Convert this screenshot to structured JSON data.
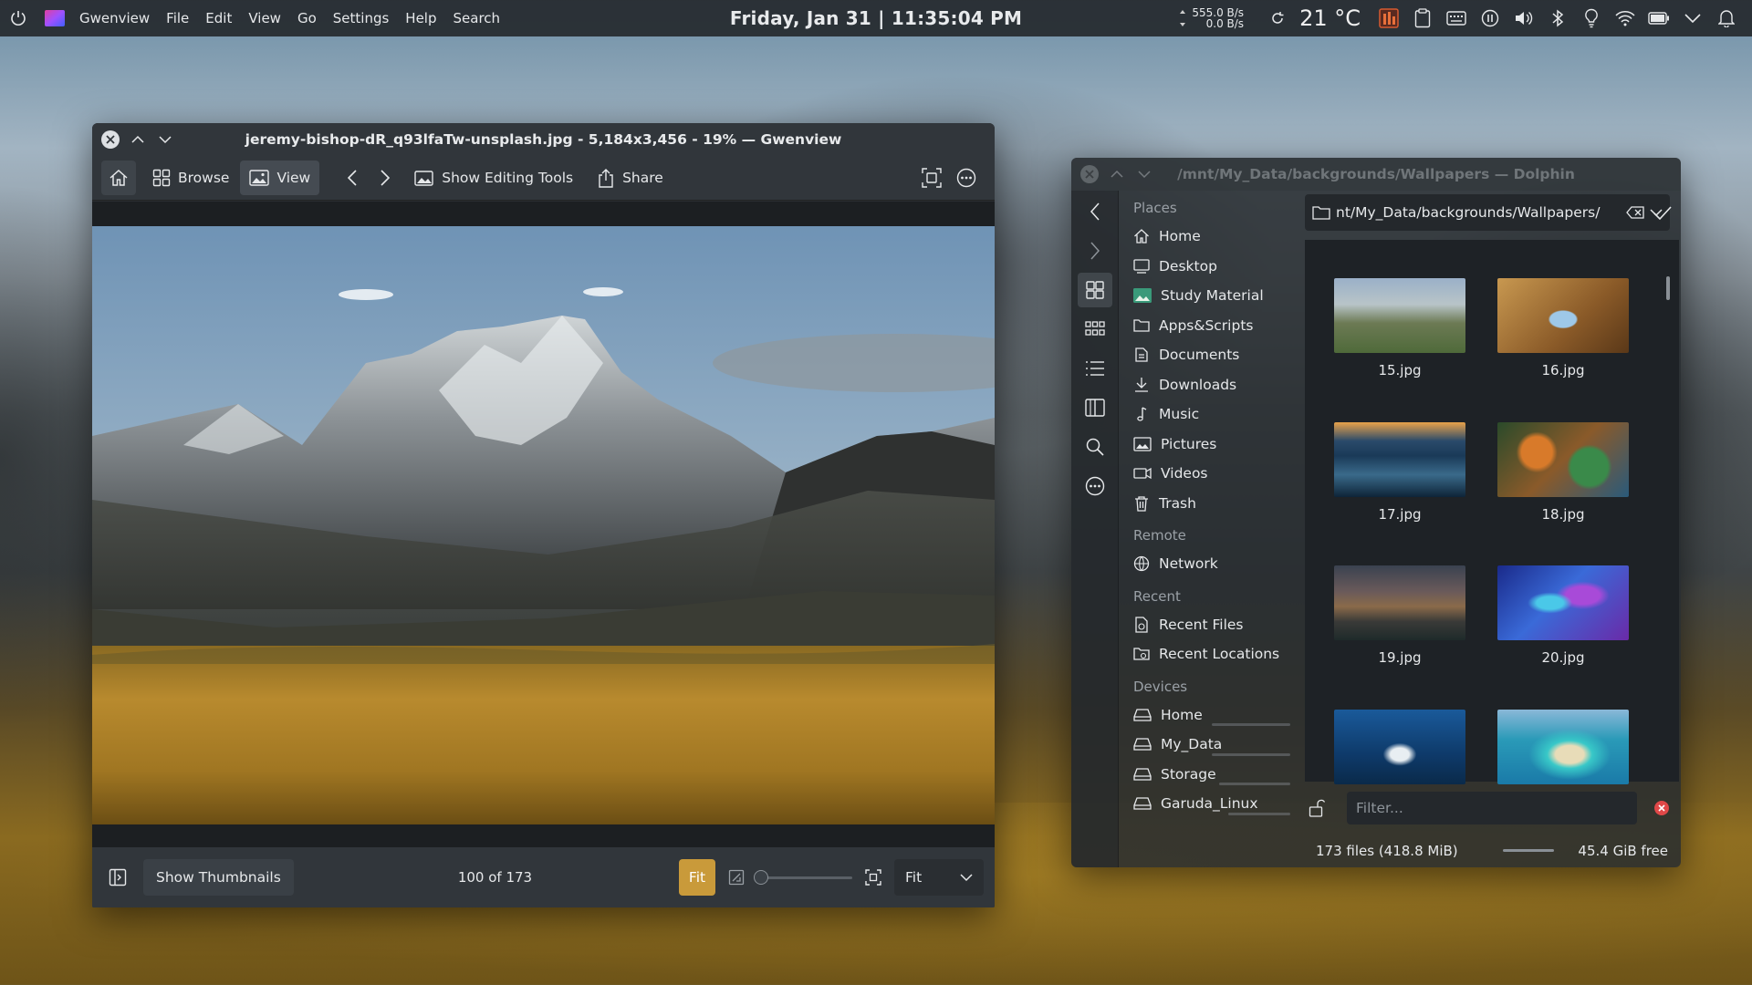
{
  "panel": {
    "app_name": "Gwenview",
    "menus": [
      "File",
      "Edit",
      "View",
      "Go",
      "Settings",
      "Help",
      "Search"
    ],
    "clock": "Friday, Jan 31 | 11:35:04 PM",
    "net_up": "555.0 B/s",
    "net_down": "0.0 B/s",
    "temperature": "21 °C",
    "icons": [
      "power-icon",
      "app-menu-icon",
      "network-speed-icon",
      "refresh-icon",
      "cpu-monitor-icon",
      "clipboard-icon",
      "keyboard-icon",
      "pause-icon",
      "volume-icon",
      "bluetooth-icon",
      "lightbulb-icon",
      "wifi-icon",
      "battery-icon",
      "chevron-down-icon",
      "notifications-icon"
    ]
  },
  "gwenview": {
    "title": "jeremy-bishop-dR_q93lfaTw-unsplash.jpg - 5,184x3,456 - 19% — Gwenview",
    "toolbar": {
      "browse": "Browse",
      "view": "View",
      "editing": "Show Editing Tools",
      "share": "Share"
    },
    "status": {
      "thumbnails": "Show Thumbnails",
      "position": "100 of 173",
      "fit_button": "Fit",
      "zoom_select": "Fit"
    }
  },
  "dolphin": {
    "title": "/mnt/My_Data/backgrounds/Wallpapers — Dolphin",
    "path": "nt/My_Data/backgrounds/Wallpapers/",
    "sections": {
      "places": "Places",
      "remote": "Remote",
      "recent": "Recent",
      "devices": "Devices"
    },
    "places": [
      "Home",
      "Desktop",
      "Study Material",
      "Apps&Scripts",
      "Documents",
      "Downloads",
      "Music",
      "Pictures",
      "Videos",
      "Trash"
    ],
    "remote": [
      "Network"
    ],
    "recent": [
      "Recent Files",
      "Recent Locations"
    ],
    "devices": [
      "Home",
      "My_Data",
      "Storage",
      "Garuda_Linux"
    ],
    "files": [
      "15.jpg",
      "16.jpg",
      "17.jpg",
      "18.jpg",
      "19.jpg",
      "20.jpg",
      "",
      ""
    ],
    "filter_placeholder": "Filter...",
    "status_files": "173 files (418.8 MiB)",
    "status_free": "45.4 GiB free"
  }
}
